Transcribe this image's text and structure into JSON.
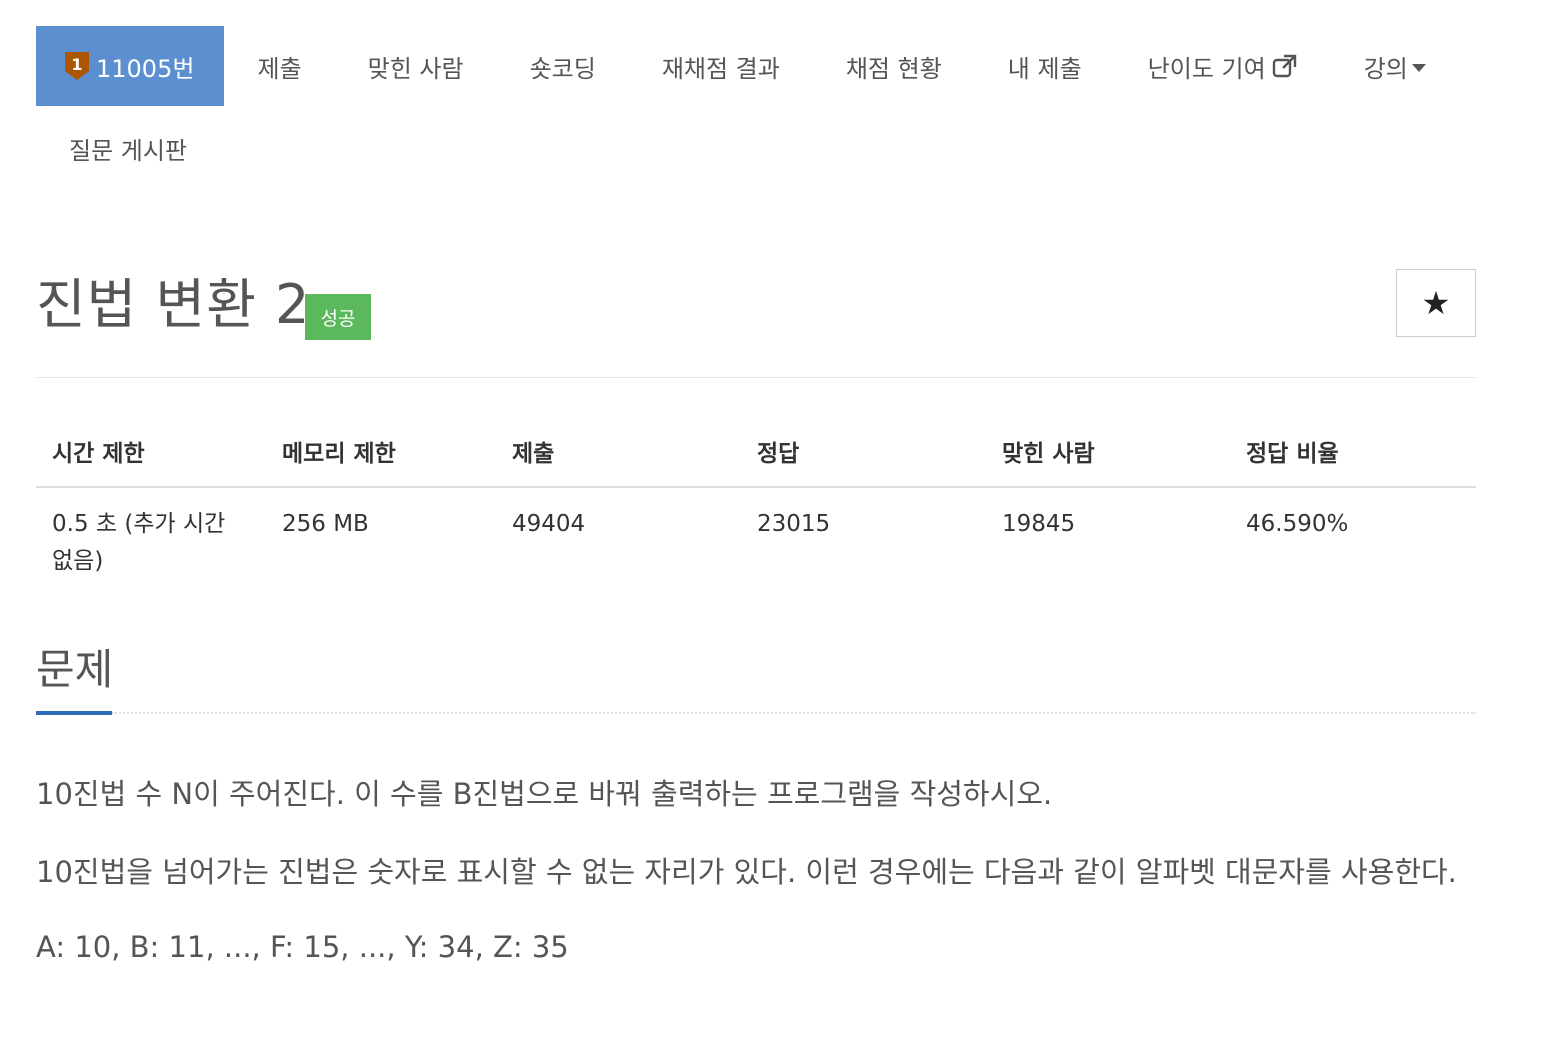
{
  "nav": {
    "problem_label": "11005번",
    "items": [
      {
        "label": "제출"
      },
      {
        "label": "맞힌 사람"
      },
      {
        "label": "숏코딩"
      },
      {
        "label": "재채점 결과"
      },
      {
        "label": "채점 현황"
      },
      {
        "label": "내 제출"
      },
      {
        "label": "난이도 기여"
      },
      {
        "label": "강의"
      }
    ],
    "row2": [
      {
        "label": "질문 게시판"
      }
    ],
    "tier_number": "1",
    "colors": {
      "active_bg": "#5b8fcf",
      "tier_badge": "#ad5600"
    }
  },
  "problem": {
    "title": "진법 변환 2",
    "status": "성공",
    "status_color": "#5cb85c",
    "star_glyph": "★"
  },
  "info_table": {
    "headers": [
      "시간 제한",
      "메모리 제한",
      "제출",
      "정답",
      "맞힌 사람",
      "정답 비율"
    ],
    "row": [
      "0.5 초 (추가 시간 없음)",
      "256 MB",
      "49404",
      "23015",
      "19845",
      "46.590%"
    ]
  },
  "section": {
    "title": "문제",
    "accent_color": "#2e6bb8"
  },
  "description": {
    "p1": "10진법 수 N이 주어진다. 이 수를 B진법으로 바꿔 출력하는 프로그램을 작성하시오.",
    "p2": "10진법을 넘어가는 진법은 숫자로 표시할 수 없는 자리가 있다. 이런 경우에는 다음과 같이 알파벳 대문자를 사용한다.",
    "p3": "A: 10, B: 11, ..., F: 15, ..., Y: 34, Z: 35"
  }
}
